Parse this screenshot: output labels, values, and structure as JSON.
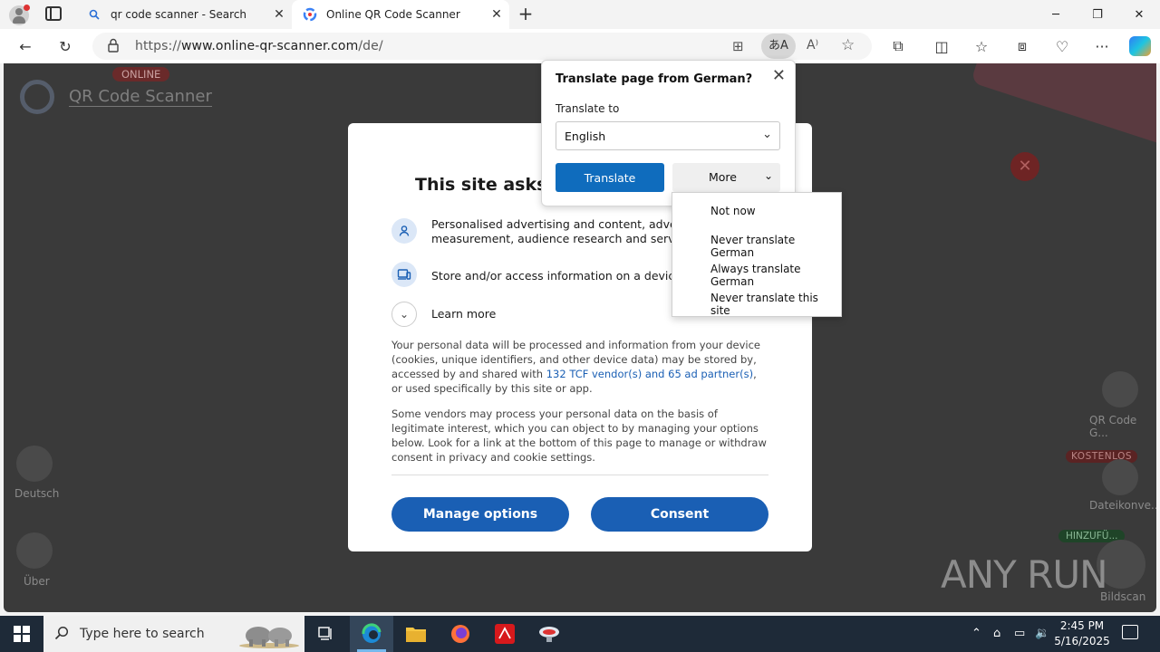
{
  "tabs": [
    {
      "title": "qr code scanner - Search",
      "active": false
    },
    {
      "title": "Online QR Code Scanner",
      "active": true
    }
  ],
  "address": {
    "prefix": "https://",
    "host": "www.online-qr-scanner.com",
    "path": "/de/"
  },
  "page": {
    "badge_online": "ONLINE",
    "site_title": "QR Code Scanner",
    "side_left": [
      "Deutsch",
      "Über"
    ],
    "side_right": [
      "QR Code G...",
      "Dateikonve...",
      "Bildscan"
    ],
    "badge_free": "KOSTENLOS",
    "badge_add": "HINZUFÜ..."
  },
  "consent": {
    "heading": "This site asks fo",
    "purposes": [
      {
        "icon": "person-icon",
        "line1": "Personalised advertising and content, advertis",
        "line2": "measurement, audience research and services"
      },
      {
        "icon": "devices-icon",
        "line1": "Store and/or access information on a device",
        "line2": ""
      }
    ],
    "learn_more": "Learn more",
    "para1_a": "Your personal data will be processed and information from your device (cookies, unique identifiers, and other device data) may be stored by, accessed by and shared with ",
    "para1_link": "132 TCF vendor(s) and 65 ad partner(s)",
    "para1_b": ", or used specifically by this site or app.",
    "para2": "Some vendors may process your personal data on the basis of legitimate interest, which you can object to by managing your options below. Look for a link at the bottom of this page to manage or withdraw consent in privacy and cookie settings.",
    "manage_label": "Manage options",
    "consent_label": "Consent"
  },
  "translate": {
    "title": "Translate page from German?",
    "to_label": "Translate to",
    "selected_language": "English",
    "translate_label": "Translate",
    "more_label": "More",
    "menu": [
      "Not now",
      "Never translate German",
      "Always translate German",
      "Never translate this site"
    ]
  },
  "taskbar": {
    "search_placeholder": "Type here to search",
    "time": "2:45 PM",
    "date": "5/16/2025"
  },
  "watermark": "ANY RUN",
  "colors": {
    "accent": "#1a5fb4",
    "translate_button": "#0f6cbd",
    "badge_red": "#c42b2b",
    "badge_green": "#1f7a3a"
  }
}
